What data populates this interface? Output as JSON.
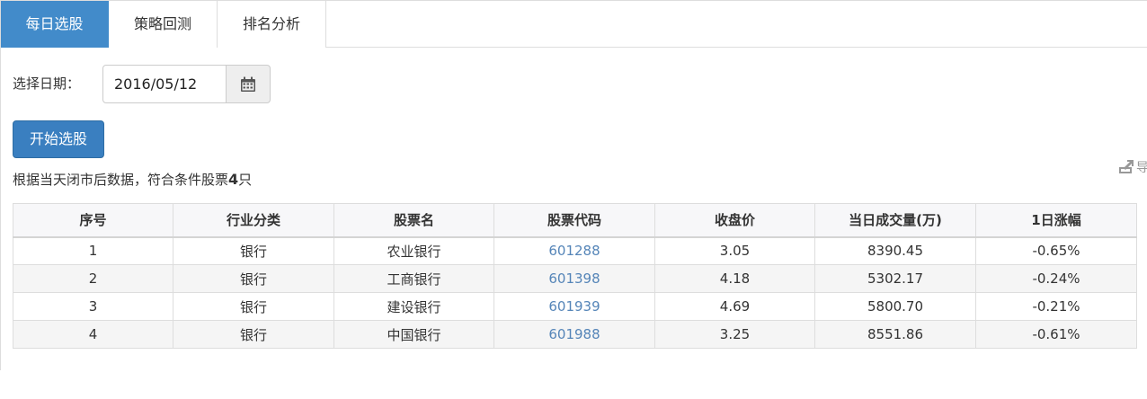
{
  "tabs": [
    {
      "label": "每日选股",
      "active": true
    },
    {
      "label": "策略回测",
      "active": false
    },
    {
      "label": "排名分析",
      "active": false
    }
  ],
  "date_picker": {
    "label": "选择日期：",
    "value": "2016/05/12",
    "icon": "calendar-icon"
  },
  "start_button": {
    "label": "开始选股"
  },
  "summary": {
    "prefix": "根据当天闭市后数据，符合条件股票",
    "count": "4",
    "suffix": "只"
  },
  "export": {
    "label": "导",
    "icon": "export-icon"
  },
  "table": {
    "headers": [
      "序号",
      "行业分类",
      "股票名",
      "股票代码",
      "收盘价",
      "当日成交量(万)",
      "1日涨幅"
    ],
    "rows": [
      [
        "1",
        "银行",
        "农业银行",
        "601288",
        "3.05",
        "8390.45",
        "-0.65%"
      ],
      [
        "2",
        "银行",
        "工商银行",
        "601398",
        "4.18",
        "5302.17",
        "-0.24%"
      ],
      [
        "3",
        "银行",
        "建设银行",
        "601939",
        "4.69",
        "5800.70",
        "-0.21%"
      ],
      [
        "4",
        "银行",
        "中国银行",
        "601988",
        "3.25",
        "8551.86",
        "-0.61%"
      ]
    ]
  },
  "colors": {
    "primary": "#428bca",
    "button": "#3a7fc0",
    "link": "#5585b8",
    "border": "#dddddd"
  }
}
